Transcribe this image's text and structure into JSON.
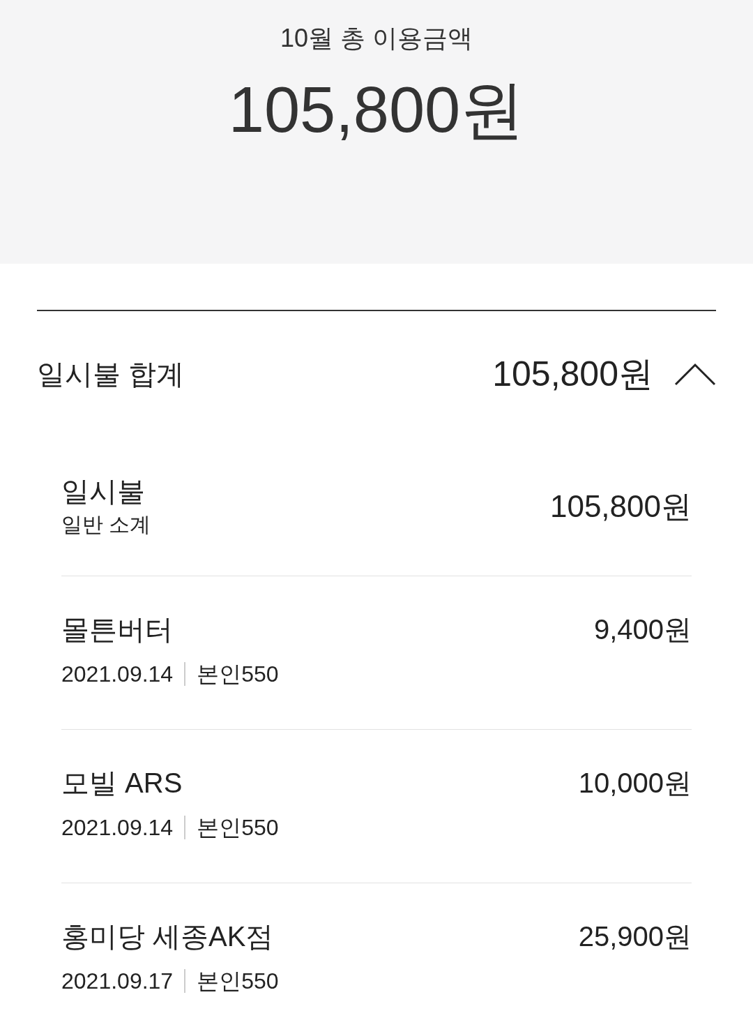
{
  "header": {
    "title": "10월 총 이용금액",
    "amount": "105,800원"
  },
  "summary": {
    "label": "일시불 합계",
    "amount": "105,800원",
    "expanded": true
  },
  "subtotal": {
    "title": "일시불",
    "subtitle": "일반 소계",
    "amount": "105,800원"
  },
  "items": [
    {
      "name": "몰튼버터",
      "amount": "9,400원",
      "date": "2021.09.14",
      "card": "본인550"
    },
    {
      "name": "모빌 ARS",
      "amount": "10,000원",
      "date": "2021.09.14",
      "card": "본인550"
    },
    {
      "name": "홍미당 세종AK점",
      "amount": "25,900원",
      "date": "2021.09.17",
      "card": "본인550"
    }
  ]
}
